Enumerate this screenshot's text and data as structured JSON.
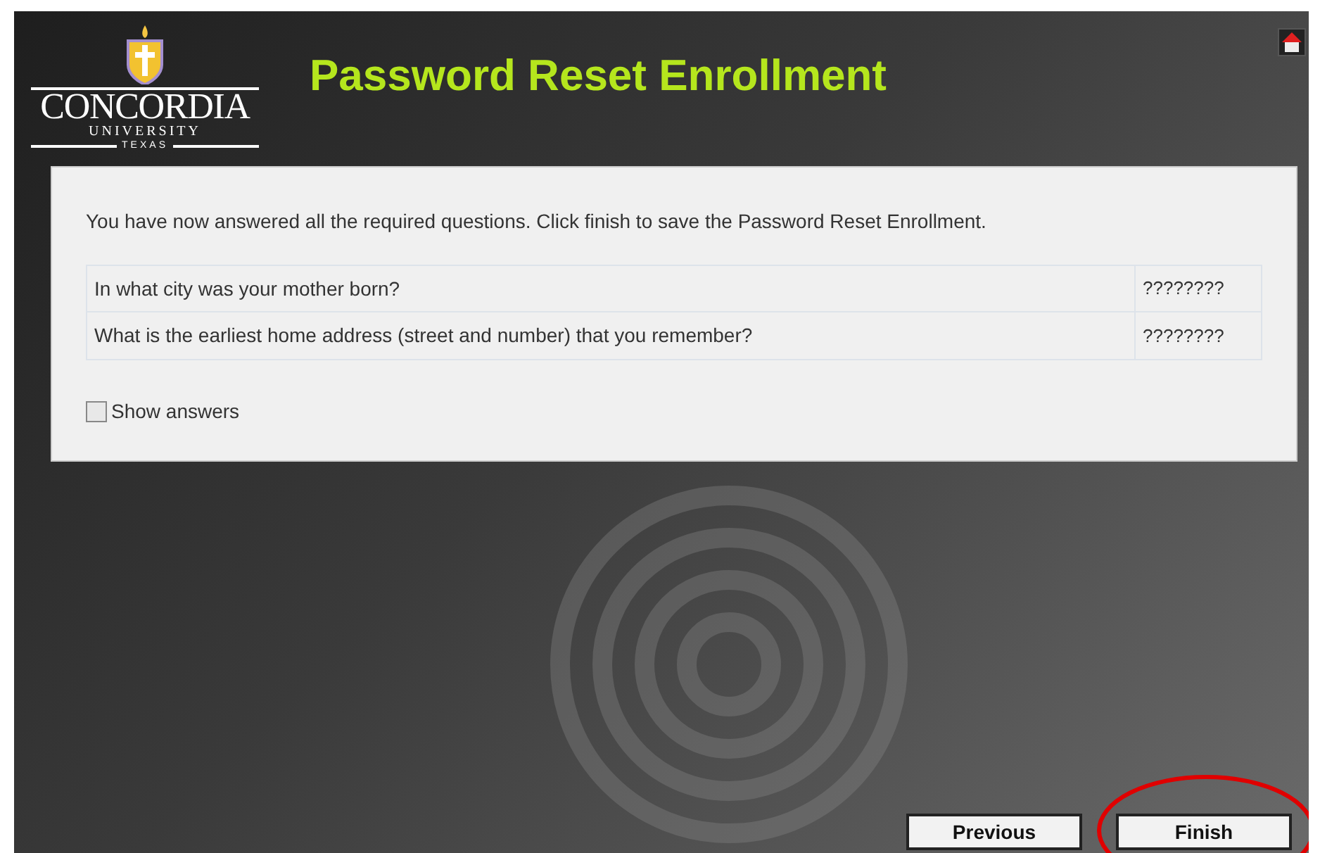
{
  "logo": {
    "name": "CONCORDIA",
    "line_2": "UNIVERSITY",
    "line_3": "TEXAS"
  },
  "title": "Password Reset Enrollment",
  "message": "You have now answered all the required questions. Click finish to save the Password Reset Enrollment.",
  "questions": [
    {
      "question": "In what city was your mother born?",
      "answer": "????????"
    },
    {
      "question": "What is the earliest home address (street and number) that you remember?",
      "answer": "????????"
    }
  ],
  "show_answers": {
    "label": "Show answers",
    "checked": false
  },
  "buttons": [
    {
      "label": "Previous",
      "highlighted": false
    },
    {
      "label": "Finish",
      "highlighted": true
    }
  ]
}
